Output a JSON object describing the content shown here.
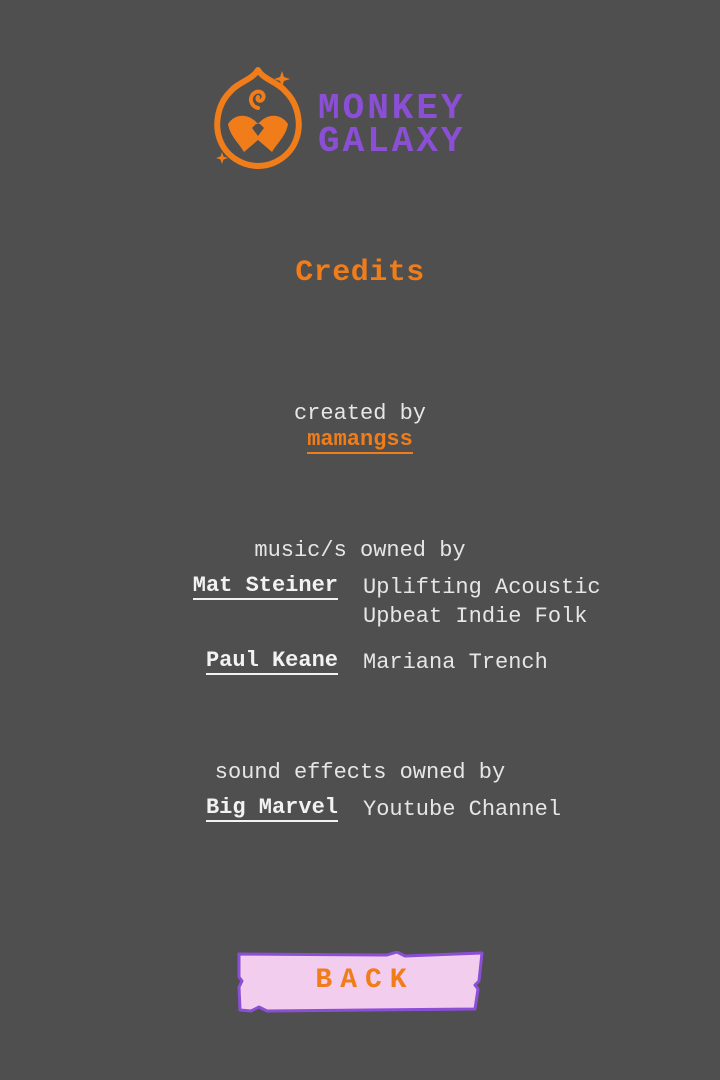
{
  "logo": {
    "line1": "MONKEY",
    "line2": "GALAXY",
    "icon": "monkey-face-icon",
    "colors": {
      "mark": "#f07d1a",
      "text": "#8b4fd6"
    }
  },
  "title": "Credits",
  "created": {
    "label": "created by",
    "author": "mamangss"
  },
  "music": {
    "title": "music/s owned by",
    "credits": [
      {
        "name": "Mat Steiner",
        "works": [
          "Uplifting Acoustic",
          "Upbeat Indie Folk"
        ]
      },
      {
        "name": "Paul Keane",
        "works": [
          "Mariana Trench"
        ]
      }
    ]
  },
  "sfx": {
    "title": "sound effects owned by",
    "credits": [
      {
        "name": "Big Marvel",
        "works": [
          "Youtube Channel"
        ]
      }
    ]
  },
  "back_button": {
    "label": "BACK",
    "colors": {
      "fill": "#f2cdee",
      "border": "#8b4fd6",
      "text": "#f07d1a"
    }
  },
  "colors": {
    "background": "#4f4f4f",
    "accent": "#f07d1a",
    "brand": "#8b4fd6",
    "text": "#e6e6e6"
  }
}
